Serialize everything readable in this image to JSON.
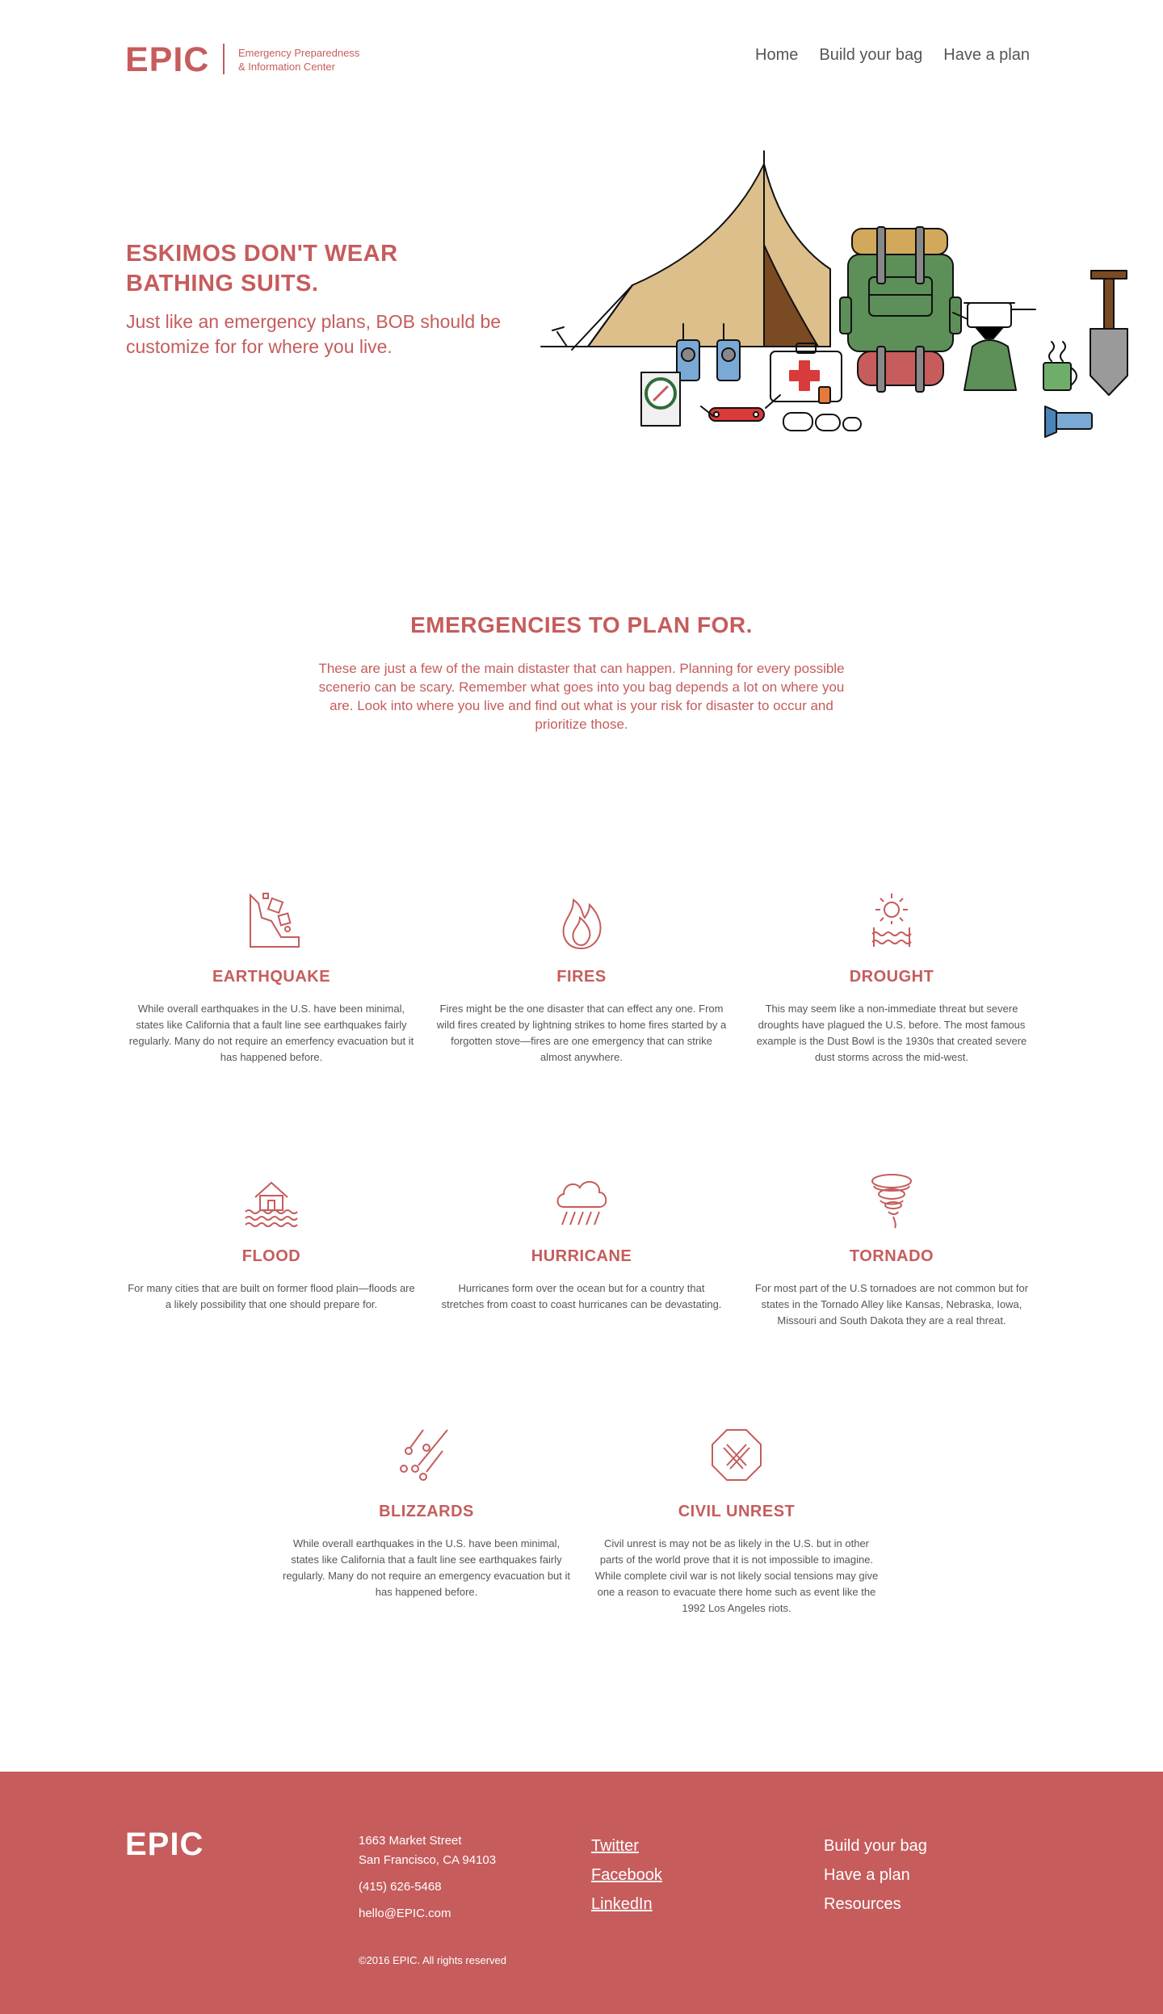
{
  "brand": {
    "logo": "EPIC",
    "tagline_line1": "Emergency Preparedness",
    "tagline_line2": "& Information Center",
    "accent_color": "#c65c5c"
  },
  "nav": {
    "items": [
      "Home",
      "Build your bag",
      "Have a plan"
    ]
  },
  "hero": {
    "title": "ESKIMOS DON'T WEAR BATHING SUITS.",
    "subtitle": "Just like an emergency plans, BOB should be customize for for where you live."
  },
  "emergencies": {
    "title": "EMERGENCIES TO PLAN FOR.",
    "intro": "These are just a few of the main distaster that can happen. Planning for every possible scenerio can be scary. Remember what goes into you bag depends a lot on where you are. Look into where you live and find out what is your risk for disaster to occur and prioritize those.",
    "cards": [
      {
        "icon": "earthquake-icon",
        "title": "EARTHQUAKE",
        "text": "While overall earthquakes in the U.S. have been minimal, states like California that a fault line see earthquakes fairly regularly. Many do not require an emerfency evacuation but it has happened before."
      },
      {
        "icon": "fire-icon",
        "title": "FIRES",
        "text": "Fires might be the one disaster that can effect any one. From wild fires created by lightning strikes to home fires started by a forgotten stove—fires are one emergency that can strike almost anywhere."
      },
      {
        "icon": "drought-icon",
        "title": "DROUGHT",
        "text": "This may seem like a non-immediate threat but severe droughts have plagued the U.S. before. The most famous example is the Dust Bowl is the 1930s that created severe dust storms across the mid-west."
      },
      {
        "icon": "flood-icon",
        "title": "FLOOD",
        "text": "For many cities that are built on former flood plain—floods are a likely possibility that one should prepare for."
      },
      {
        "icon": "hurricane-icon",
        "title": "HURRICANE",
        "text": "Hurricanes form over the ocean but for a country that stretches from coast to coast hurricanes can be devastating."
      },
      {
        "icon": "tornado-icon",
        "title": "TORNADO",
        "text": "For most part of the U.S tornadoes are not common but for states in the Tornado Alley like Kansas, Nebraska, Iowa, Missouri and South Dakota they are a real threat."
      },
      {
        "icon": "blizzard-icon",
        "title": "BLIZZARDS",
        "text": "While overall earthquakes in the U.S. have been minimal, states like California that a fault line see earthquakes fairly regularly. Many do not require an emergency evacuation but it has happened before."
      },
      {
        "icon": "civil-unrest-icon",
        "title": "CIVIL UNREST",
        "text": "Civil unrest is may not be as likely in the U.S. but in other parts of the world prove that it is not impossible to imagine. While complete civil war is not likely social tensions may give one a reason to evacuate there home such as event like the 1992 Los Angeles riots."
      }
    ]
  },
  "footer": {
    "logo": "EPIC",
    "address_line1": "1663 Market Street",
    "address_line2": "San Francisco, CA 94103",
    "phone": "(415) 626-5468",
    "email": "hello@EPIC.com",
    "copyright": "©2016 EPIC. All rights reserved",
    "social": [
      "Twitter",
      "Facebook",
      "LinkedIn"
    ],
    "links": [
      "Build your bag",
      "Have a plan",
      "Resources"
    ]
  }
}
